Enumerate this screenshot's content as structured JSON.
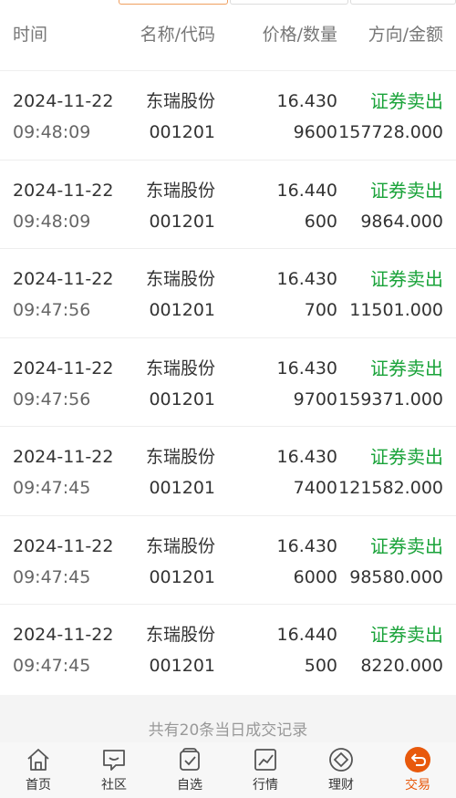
{
  "header": {
    "col_time": "时间",
    "col_name_code": "名称/代码",
    "col_price_qty": "价格/数量",
    "col_dir_amount": "方向/金额"
  },
  "trades": [
    {
      "date": "2024-11-22",
      "time": "09:48:09",
      "name": "东瑞股份",
      "code": "001201",
      "price": "16.430",
      "qty": "9600",
      "direction": "证券卖出",
      "amount": "157728.000"
    },
    {
      "date": "2024-11-22",
      "time": "09:48:09",
      "name": "东瑞股份",
      "code": "001201",
      "price": "16.440",
      "qty": "600",
      "direction": "证券卖出",
      "amount": "9864.000"
    },
    {
      "date": "2024-11-22",
      "time": "09:47:56",
      "name": "东瑞股份",
      "code": "001201",
      "price": "16.430",
      "qty": "700",
      "direction": "证券卖出",
      "amount": "11501.000"
    },
    {
      "date": "2024-11-22",
      "time": "09:47:56",
      "name": "东瑞股份",
      "code": "001201",
      "price": "16.430",
      "qty": "9700",
      "direction": "证券卖出",
      "amount": "159371.000"
    },
    {
      "date": "2024-11-22",
      "time": "09:47:45",
      "name": "东瑞股份",
      "code": "001201",
      "price": "16.430",
      "qty": "7400",
      "direction": "证券卖出",
      "amount": "121582.000"
    },
    {
      "date": "2024-11-22",
      "time": "09:47:45",
      "name": "东瑞股份",
      "code": "001201",
      "price": "16.430",
      "qty": "6000",
      "direction": "证券卖出",
      "amount": "98580.000"
    },
    {
      "date": "2024-11-22",
      "time": "09:47:45",
      "name": "东瑞股份",
      "code": "001201",
      "price": "16.440",
      "qty": "500",
      "direction": "证券卖出",
      "amount": "8220.000"
    }
  ],
  "footer": {
    "summary": "共有20条当日成交记录"
  },
  "tabbar": {
    "items": [
      {
        "label": "首页",
        "icon": "home-icon"
      },
      {
        "label": "社区",
        "icon": "chat-icon"
      },
      {
        "label": "自选",
        "icon": "watchlist-icon"
      },
      {
        "label": "行情",
        "icon": "chart-icon"
      },
      {
        "label": "理财",
        "icon": "diamond-icon"
      },
      {
        "label": "交易",
        "icon": "trade-icon",
        "active": true
      }
    ]
  },
  "colors": {
    "sell": "#1aa33a",
    "active_tab": "#e8590c"
  }
}
